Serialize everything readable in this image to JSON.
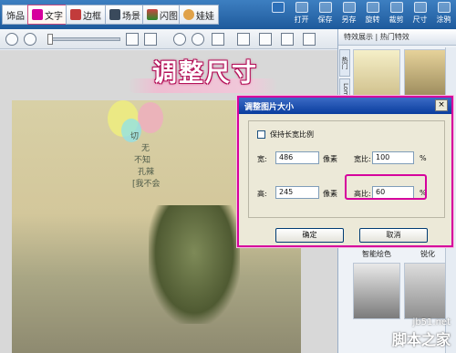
{
  "toolbar": {
    "tabs": [
      {
        "label": "饰品",
        "active": false
      },
      {
        "label": "文字",
        "active": true
      },
      {
        "label": "边框",
        "active": false
      },
      {
        "label": "场景",
        "active": false
      },
      {
        "label": "闪图",
        "active": false
      },
      {
        "label": "娃娃",
        "active": false
      }
    ],
    "actions": [
      "打开",
      "保存",
      "另存",
      "旋转",
      "裁剪",
      "尺寸",
      "涂鸦"
    ]
  },
  "right_panel": {
    "header": "特效展示 | 热门特效",
    "vertical_tabs": [
      "热门",
      "Lomo"
    ],
    "thumb_labels": [
      "智能绘色",
      "锐化"
    ]
  },
  "overlay_title": "调整尺寸",
  "photo_handwriting": [
    "切",
    "无",
    "不知",
    "孔辣",
    "[我不会"
  ],
  "dialog": {
    "title": "调整图片大小",
    "close": "×",
    "keep_ratio_label": "保持长宽比例",
    "width_label": "宽:",
    "width_value": "486",
    "width_unit": "像素",
    "width_ratio_label": "宽比:",
    "width_ratio_value": "100",
    "width_ratio_unit": "%",
    "height_label": "高:",
    "height_value": "245",
    "height_unit": "像素",
    "height_ratio_label": "高比:",
    "height_ratio_value": "60",
    "height_ratio_unit": "%",
    "ok_button": "确定",
    "cancel_button": "取消"
  },
  "watermark": {
    "line1": "jb51.net",
    "line2": "脚本之家"
  },
  "colors": {
    "accent": "#d6009d",
    "titlebar": "#0a3d9e",
    "toolbar": "#1e5a9c"
  }
}
